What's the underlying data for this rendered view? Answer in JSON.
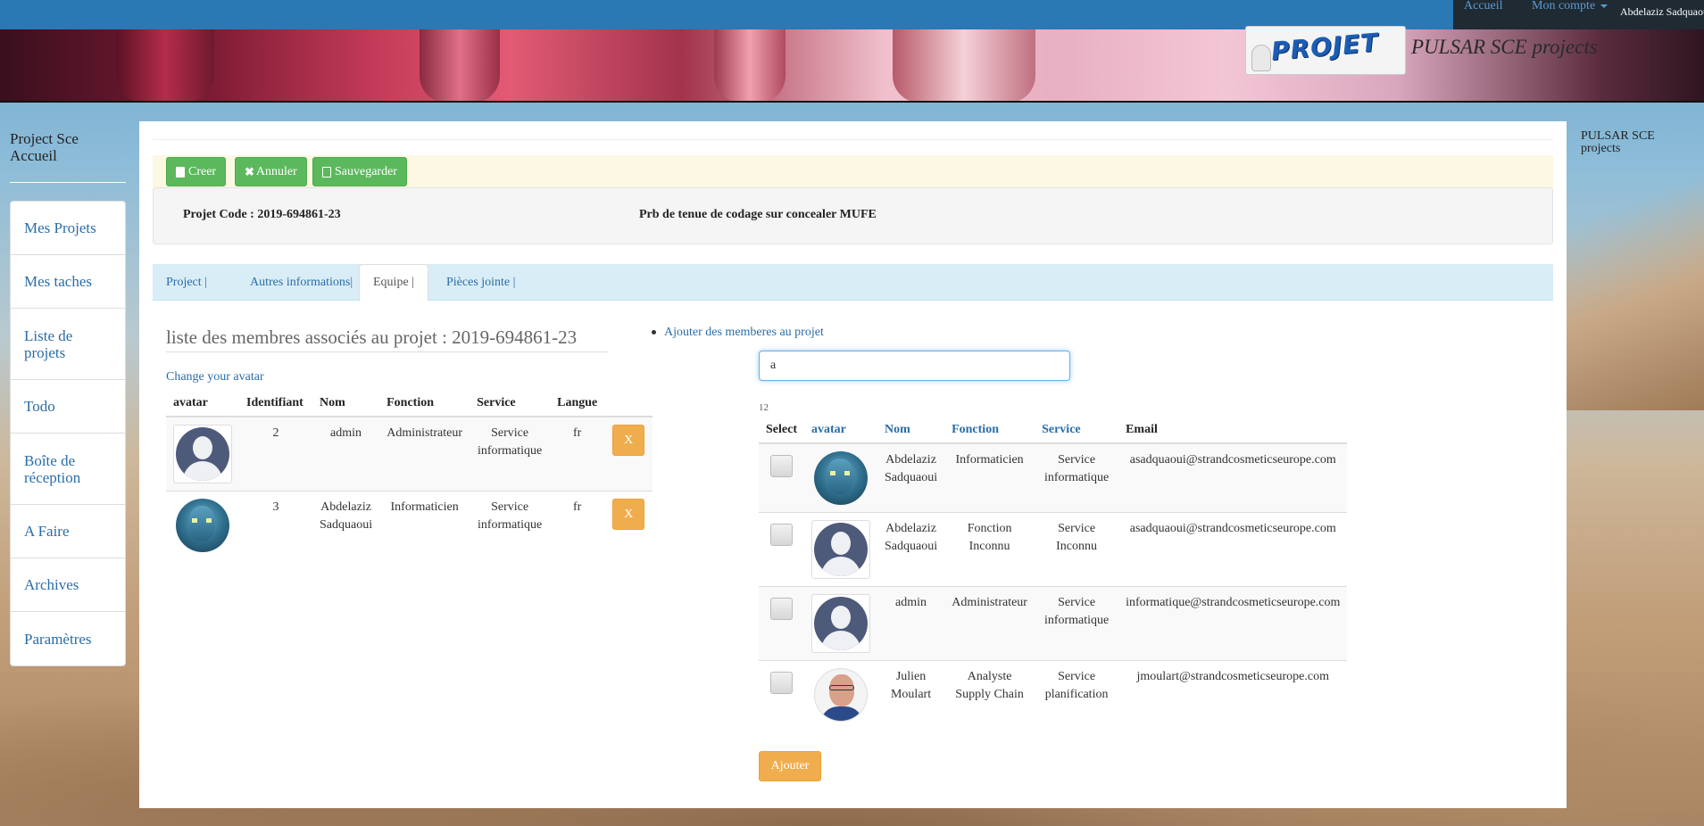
{
  "navbar": {
    "home": "Accueil",
    "account": "Mon compte",
    "user": "Abdelaziz Sadquaoui"
  },
  "banner": {
    "logo_text": "PROJET",
    "brand": "PULSAR SCE projects"
  },
  "sidebar": {
    "title": "Project Sce Accueil",
    "items": [
      {
        "label": "Mes Projets"
      },
      {
        "label": "Mes taches"
      },
      {
        "label": "Liste de projets"
      },
      {
        "label": "Todo"
      },
      {
        "label": "Boîte de réception"
      },
      {
        "label": "A Faire"
      },
      {
        "label": "Archives"
      },
      {
        "label": "Paramètres"
      }
    ]
  },
  "right_sidebar": {
    "brand": "PULSAR SCE projects"
  },
  "toolbar": {
    "create": "Creer",
    "cancel": "Annuler",
    "save": "Sauvegarder"
  },
  "project": {
    "code_label": "Projet Code : 2019-694861-23",
    "description": "Prb de tenue de codage sur concealer MUFE"
  },
  "tabs": [
    {
      "label": "Project |"
    },
    {
      "label": "Autres informations|"
    },
    {
      "label": "Equipe |"
    },
    {
      "label": "Pièces jointe |"
    }
  ],
  "members": {
    "title": "liste des membres associés au projet : 2019-694861-23",
    "change_avatar": "Change your avatar",
    "columns": [
      "avatar",
      "Identifiant",
      "Nom",
      "Fonction",
      "Service",
      "Langue"
    ],
    "remove_label": "X",
    "rows": [
      {
        "avatar": "default-avatar",
        "id": "2",
        "name": "admin",
        "function": "Administrateur",
        "service": "Service informatique",
        "lang": "fr"
      },
      {
        "avatar": "avatar-photo",
        "id": "3",
        "name": "Abdelaziz Sadquaoui",
        "function": "Informaticien",
        "service": "Service informatique",
        "lang": "fr"
      }
    ]
  },
  "add_members": {
    "link": "Ajouter des memberes au projet",
    "search_value": "a",
    "count": "12",
    "columns": [
      "Select",
      "avatar",
      "Nom",
      "Fonction",
      "Service",
      "Email"
    ],
    "rows": [
      {
        "avatar": "avatar-photo",
        "name": "Abdelaziz Sadquaoui",
        "function": "Informaticien",
        "service": "Service informatique",
        "email": "asadquaoui@strandcosmeticseurope.com"
      },
      {
        "avatar": "default-avatar",
        "name": "Abdelaziz Sadquaoui",
        "function": "Fonction Inconnu",
        "service": "Service Inconnu",
        "email": "asadquaoui@strandcosmeticseurope.com"
      },
      {
        "avatar": "default-avatar",
        "name": "admin",
        "function": "Administrateur",
        "service": "Service informatique",
        "email": "informatique@strandcosmeticseurope.com"
      },
      {
        "avatar": "user-photo",
        "name": "Julien Moulart",
        "function": "Analyste Supply Chain",
        "service": "Service planification",
        "email": "jmoulart@strandcosmeticseurope.com"
      }
    ],
    "add_button": "Ajouter"
  }
}
